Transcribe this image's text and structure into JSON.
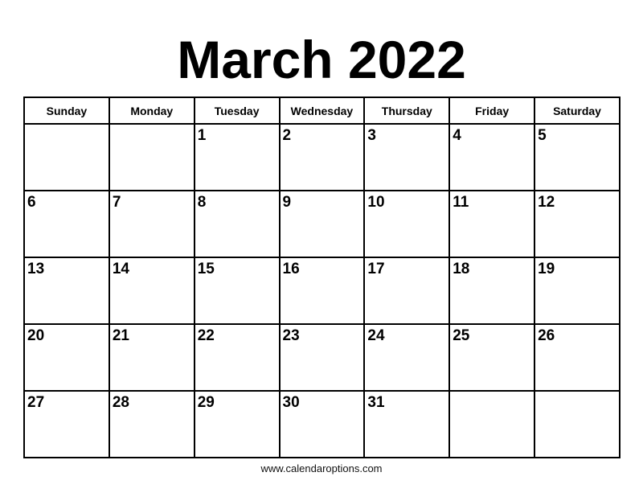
{
  "title": "March 2022",
  "weekdays": [
    "Sunday",
    "Monday",
    "Tuesday",
    "Wednesday",
    "Thursday",
    "Friday",
    "Saturday"
  ],
  "weeks": [
    [
      "",
      "",
      "1",
      "2",
      "3",
      "4",
      "5"
    ],
    [
      "6",
      "7",
      "8",
      "9",
      "10",
      "11",
      "12"
    ],
    [
      "13",
      "14",
      "15",
      "16",
      "17",
      "18",
      "19"
    ],
    [
      "20",
      "21",
      "22",
      "23",
      "24",
      "25",
      "26"
    ],
    [
      "27",
      "28",
      "29",
      "30",
      "31",
      "",
      ""
    ]
  ],
  "footer": "www.calendaroptions.com"
}
